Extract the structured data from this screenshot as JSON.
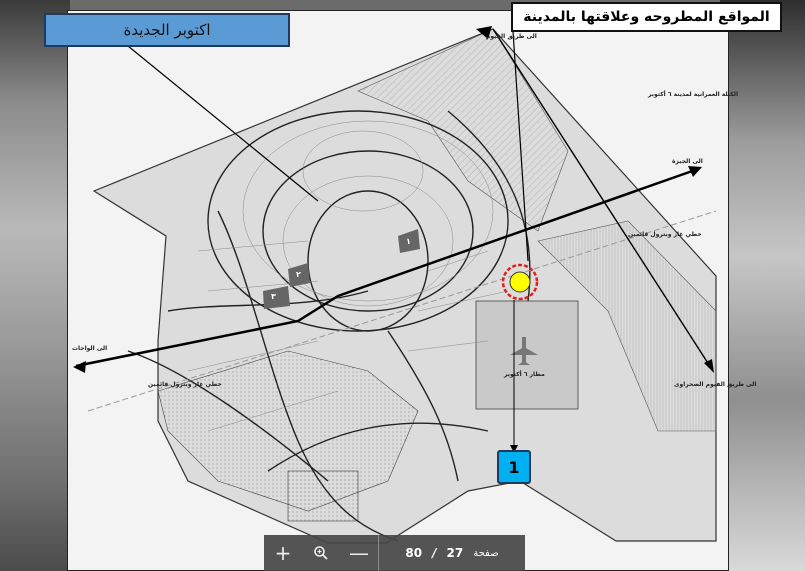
{
  "title": "المواقع المطروحه وعلاقتها بالمدينة",
  "callout": "اكتوبر الجديدة",
  "site_marker": "1",
  "map_labels": {
    "to_giza": "الى الجيزة",
    "to_oases": "الى الواحات",
    "to_fayoum_road": "الى طريق الفيوم الصحراوى",
    "gas_line_top": "خطي غاز وبترول قائمين",
    "gas_line_bottom": "خطي غاز وبترول قائمين",
    "urban_block": "الكتلة العمرانية لمدينة ٦ أكتوبر",
    "airport": "مطار ٦ أكتوبر",
    "fayoum_top": "الى طريق الفيوم",
    "zone_1": "١",
    "zone_2": "٢",
    "zone_3": "٣"
  },
  "toolbar": {
    "zoom_in": "+",
    "zoom_icon": "magnifier-icon",
    "zoom_out": "—",
    "total_pages": "80",
    "slash": "/",
    "current_page": "27",
    "page_label": "صفحة"
  },
  "colors": {
    "marker_fill": "#ffff00",
    "marker_ring": "#e02020",
    "callout_fill": "#5b9bd5",
    "marker_box_fill": "#00b0f0"
  }
}
